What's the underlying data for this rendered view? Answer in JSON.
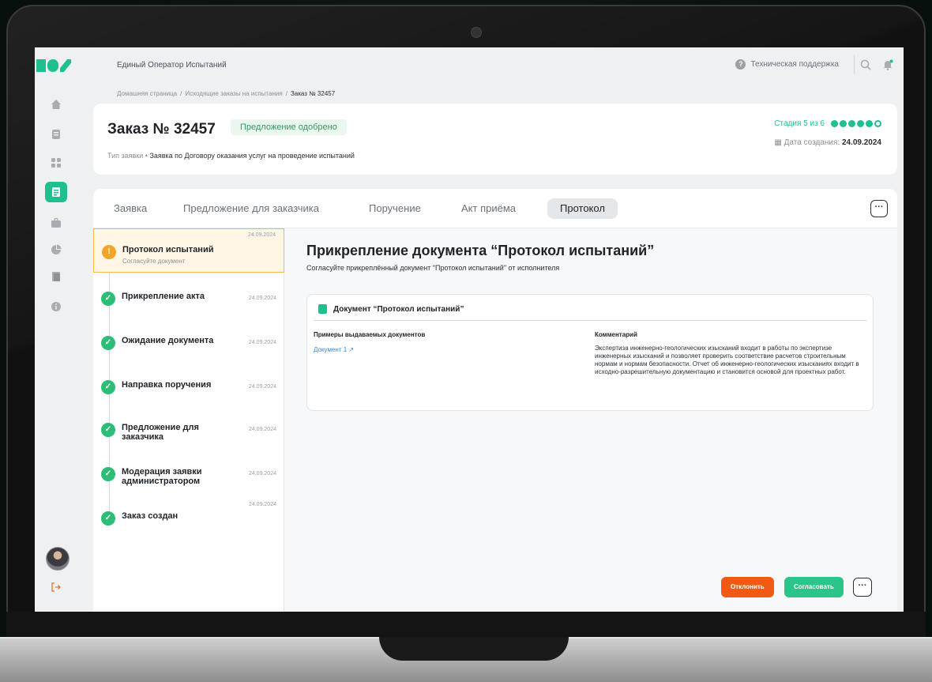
{
  "app": {
    "title": "Единый Оператор Испытаний"
  },
  "topbar": {
    "support_label": "Техническая поддержка"
  },
  "breadcrumb": {
    "items": [
      "Домашняя страница",
      "Исходящие заказы на испытания",
      "Заказ № 32457"
    ]
  },
  "order": {
    "title": "Заказ № 32457",
    "status": "Предложение одобрено",
    "type_label": "Тип заявки",
    "type_value": "Заявка по Договору оказания услуг на проведение испытаний",
    "stage": {
      "label": "Стадия 5 из 6",
      "current": 5,
      "total": 6
    },
    "created_label": "Дата создания:",
    "created_value": "24.09.2024"
  },
  "tabs": [
    {
      "label": "Заявка"
    },
    {
      "label": "Предложение для заказчика"
    },
    {
      "label": "Поручение"
    },
    {
      "label": "Акт приёма"
    },
    {
      "label": "Протокол"
    }
  ],
  "tabs_more": "···",
  "timeline": [
    {
      "title": "Протокол испытаний",
      "sub": "Согласуйте документ",
      "date": "24.09.2024",
      "state": "pending"
    },
    {
      "title": "Прикрепление акта",
      "sub": "",
      "date": "24.09.2024",
      "state": "done"
    },
    {
      "title": "Ожидание документа",
      "sub": "",
      "date": "24.09.2024",
      "state": "done"
    },
    {
      "title": "Направка поручения",
      "sub": "",
      "date": "24.09.2024",
      "state": "done"
    },
    {
      "title": "Предложение для заказчика",
      "sub": "",
      "date": "24.09.2024",
      "state": "done"
    },
    {
      "title": "Модерация заявки администратором",
      "sub": "",
      "date": "24.09.2024",
      "state": "done"
    },
    {
      "title": "Заказ создан",
      "sub": "",
      "date": "24.09.2024",
      "state": "done"
    }
  ],
  "content": {
    "title": "Прикрепление документа “Протокол испытаний”",
    "subtitle": "Согласуйте прикреплённый документ \"Протокол испытаний\" от исполнителя",
    "doc_card": {
      "title": "Документ “Протокол испытаний”",
      "examples_header": "Примеры выдаваемых документов",
      "comment_header": "Комментарий",
      "link": "Документ 1 ↗",
      "comment": "Экспертиза инженерно-геологических изысканий входит в работы по экспертизе инженерных изысканий и позволяет проверить соответствие расчетов строительным нормам и нормам безопасности. Отчет об инженерно-геологических изысканиях входит в исходно-разрешительную документацию и становится основой для проектных работ."
    },
    "actions": {
      "reject": "Отклонить",
      "approve": "Согласовать",
      "more": "···"
    }
  },
  "colors": {
    "accent": "#1fbf8f",
    "reject": "#f05a14",
    "approve": "#2bc58c",
    "pending": "#f5a42a",
    "done": "#2ebd76"
  }
}
